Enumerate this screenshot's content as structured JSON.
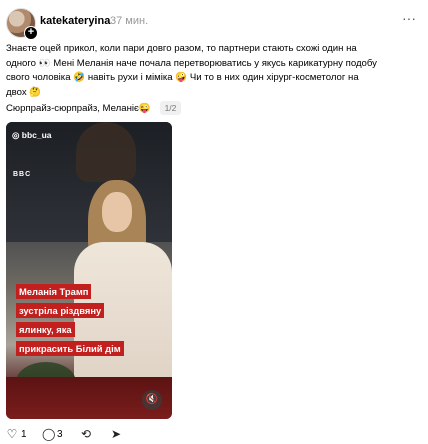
{
  "post": {
    "username": "katekateryina",
    "time": "37 мин.",
    "more_glyph": "···",
    "body_lines": [
      "Знаєте оцей прикол, коли пари довго разом, то партнери стають схожі один на",
      "одного 👀 Мені Меланія наче почала перетворюватись у якусь карикатурну подобу",
      "свого чоловіка 🤣 навіть рухи і міміка 🤪 Чи то в них один хірург-косметолог на",
      "двох 🤔"
    ],
    "caption": "Сюрпрайз-сюрпрайз, Меланіє😜",
    "page_count": "1/2"
  },
  "media": {
    "ig_tag": "bbc_ua",
    "bbc_logo": "BBC",
    "overlay_lines": [
      "Меланія Трамп",
      "зустріла різдвяну",
      "ялинку, яка",
      "прикрасить Білий дім"
    ],
    "mute_icon": "mute-icon"
  },
  "actions": {
    "like_count": "1",
    "comment_count": "3",
    "icons": [
      "heart-icon",
      "comment-icon",
      "repost-icon",
      "share-icon"
    ]
  }
}
